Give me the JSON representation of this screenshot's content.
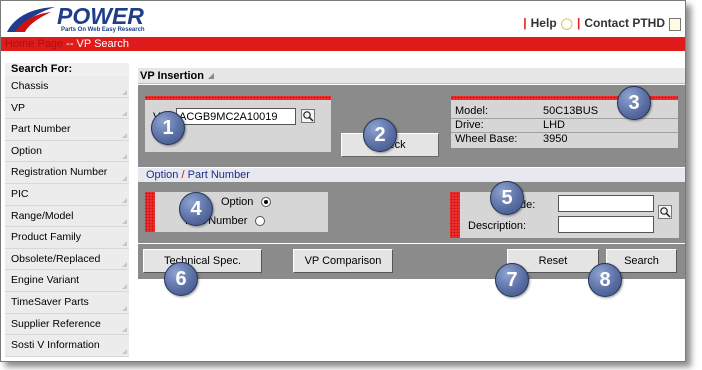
{
  "header": {
    "logo_name": "POWER",
    "logo_tagline": "Parts On Web Easy Research",
    "help_label": "Help",
    "contact_label": "Contact PTHD"
  },
  "breadcrumb": {
    "home": "Home Page",
    "separator": " -- ",
    "current": "VP Search"
  },
  "sidebar": {
    "heading": "Search For:",
    "items": [
      {
        "label": "Chassis"
      },
      {
        "label": "VP"
      },
      {
        "label": "Part Number"
      },
      {
        "label": "Option"
      },
      {
        "label": "Registration Number"
      },
      {
        "label": "PIC"
      },
      {
        "label": "Range/Model"
      },
      {
        "label": "Product Family"
      },
      {
        "label": "Obsolete/Replaced"
      },
      {
        "label": "Engine Variant"
      },
      {
        "label": "TimeSaver Parts"
      },
      {
        "label": "Supplier Reference"
      },
      {
        "label": "Sosti V Information"
      }
    ]
  },
  "vp_insertion": {
    "title": "VP Insertion",
    "vp_label": "VP",
    "vp_value": "ACGB9MC2A10019",
    "check_label": "Check",
    "info": [
      {
        "key": "Model:",
        "value": "50C13BUS"
      },
      {
        "key": "Drive:",
        "value": "LHD"
      },
      {
        "key": "Wheel Base:",
        "value": "3950"
      }
    ]
  },
  "option_section": {
    "title_option": "Option",
    "title_sep": "/",
    "title_part": "Part Number",
    "radio_option_label": "Option",
    "radio_part_label": "Part Number",
    "code_label": "Code:",
    "description_label": "Description:",
    "code_value": "",
    "description_value": ""
  },
  "buttons": {
    "technical_spec": "Technical Spec.",
    "vp_comparison": "VP Comparison",
    "reset": "Reset",
    "search": "Search"
  },
  "callouts": [
    "1",
    "2",
    "3",
    "4",
    "5",
    "6",
    "7",
    "8"
  ],
  "colors": {
    "brand_blue": "#1f3d8c",
    "accent_red": "#e01b1b",
    "panel_gray": "#8b8b8b",
    "callout_blue": "#5a6fa4"
  }
}
